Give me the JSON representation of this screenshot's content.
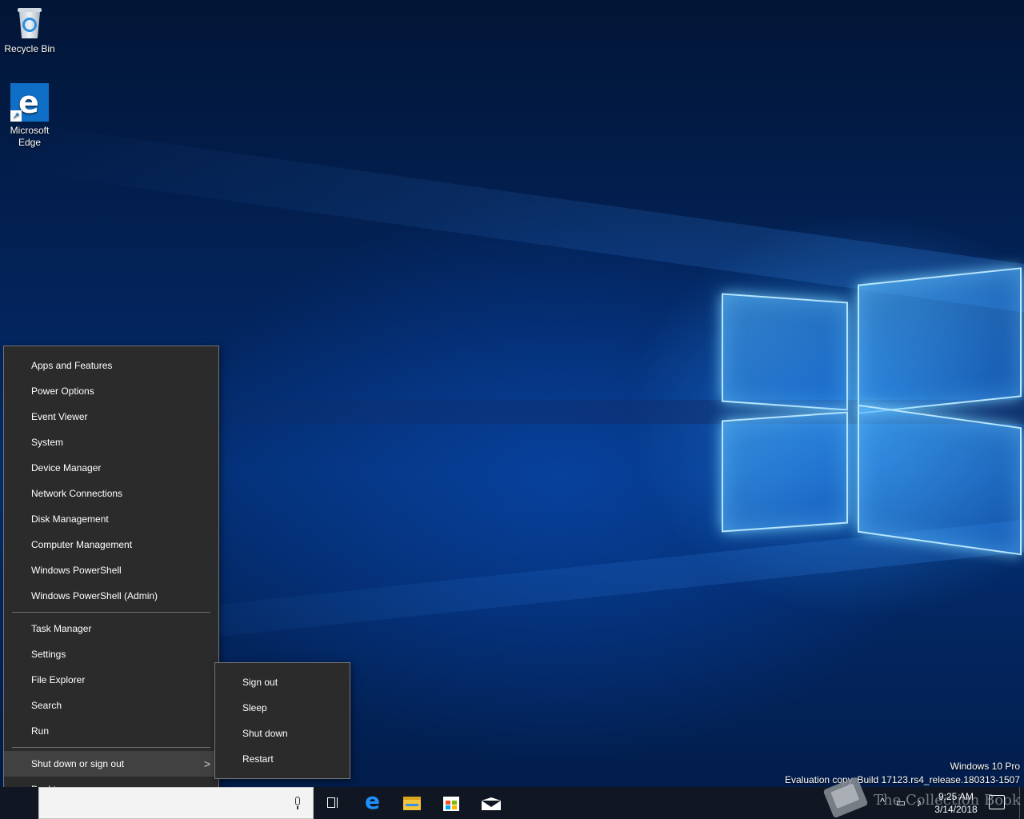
{
  "desktop_icons": [
    {
      "label": "Recycle Bin",
      "icon": "recycle-bin-icon"
    },
    {
      "label": "Microsoft Edge",
      "icon": "edge-icon"
    }
  ],
  "winx_menu": {
    "group1": [
      "Apps and Features",
      "Power Options",
      "Event Viewer",
      "System",
      "Device Manager",
      "Network Connections",
      "Disk Management",
      "Computer Management",
      "Windows PowerShell",
      "Windows PowerShell (Admin)"
    ],
    "group2": [
      "Task Manager",
      "Settings",
      "File Explorer",
      "Search",
      "Run"
    ],
    "shutdown_label": "Shut down or sign out",
    "desktop_label": "Desktop"
  },
  "shutdown_submenu": [
    "Sign out",
    "Sleep",
    "Shut down",
    "Restart"
  ],
  "watermark": {
    "edition": "Windows 10 Pro",
    "build": "Evaluation copy. Build 17123.rs4_release.180313-1507"
  },
  "taskbar": {
    "search_placeholder": "",
    "pinned": [
      "task-view-icon",
      "edge-icon",
      "file-explorer-icon",
      "store-icon",
      "mail-icon"
    ],
    "clock_time": "9:25 AM",
    "clock_date": "3/14/2018"
  },
  "brand_overlay": "The Collection Book",
  "colors": {
    "menu_bg": "#2b2b2b",
    "menu_active": "#414141",
    "taskbar_bg": "#101622",
    "accent": "#0f6fc6"
  }
}
